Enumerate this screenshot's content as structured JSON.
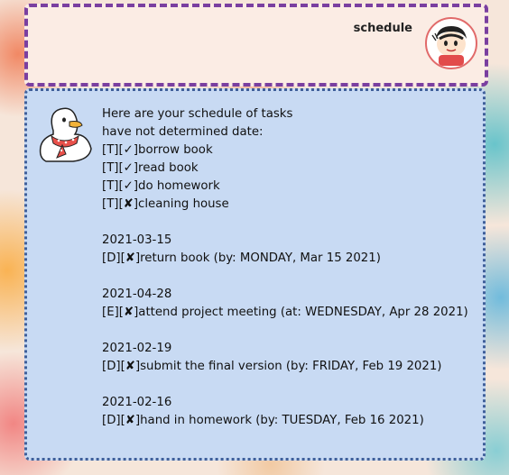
{
  "user_message": {
    "text": "schedule",
    "avatar": "cartoon-boy-avatar"
  },
  "bot_message": {
    "avatar": "duck-with-scarf-avatar",
    "header_lines": [
      "Here are your schedule of tasks",
      "have not determined date:"
    ],
    "undated_tasks": [
      "[T][✓]borrow book",
      "[T][✓]read book",
      "[T][✓]do homework",
      "[T][✘]cleaning house"
    ],
    "dated_groups": [
      {
        "date": "2021-03-15",
        "task": "[D][✘]return book (by: MONDAY, Mar 15 2021)"
      },
      {
        "date": "2021-04-28",
        "task": "[E][✘]attend project meeting (at: WEDNESDAY, Apr 28 2021)"
      },
      {
        "date": "2021-02-19",
        "task": "[D][✘]submit the final version (by: FRIDAY, Feb 19 2021)"
      },
      {
        "date": "2021-02-16",
        "task": "[D][✘]hand in homework (by: TUESDAY, Feb 16 2021)"
      }
    ]
  },
  "colors": {
    "user_bubble_bg": "#fbece4",
    "user_bubble_border": "#7a3fa0",
    "bot_bubble_bg": "#c8daf3",
    "bot_bubble_border": "#3f5f9a"
  }
}
